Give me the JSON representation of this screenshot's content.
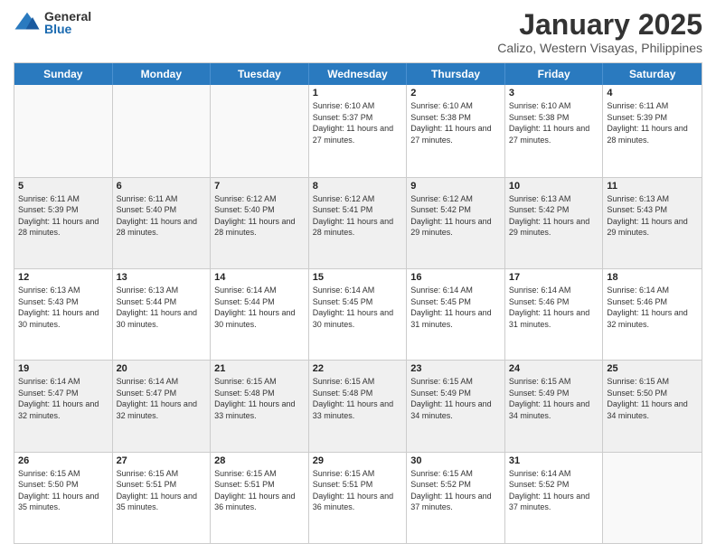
{
  "logo": {
    "general": "General",
    "blue": "Blue"
  },
  "header": {
    "month": "January 2025",
    "location": "Calizo, Western Visayas, Philippines"
  },
  "weekdays": [
    "Sunday",
    "Monday",
    "Tuesday",
    "Wednesday",
    "Thursday",
    "Friday",
    "Saturday"
  ],
  "weeks": [
    [
      {
        "day": "",
        "empty": true
      },
      {
        "day": "",
        "empty": true
      },
      {
        "day": "",
        "empty": true
      },
      {
        "day": "1",
        "sunrise": "6:10 AM",
        "sunset": "5:37 PM",
        "daylight": "11 hours and 27 minutes."
      },
      {
        "day": "2",
        "sunrise": "6:10 AM",
        "sunset": "5:38 PM",
        "daylight": "11 hours and 27 minutes."
      },
      {
        "day": "3",
        "sunrise": "6:10 AM",
        "sunset": "5:38 PM",
        "daylight": "11 hours and 27 minutes."
      },
      {
        "day": "4",
        "sunrise": "6:11 AM",
        "sunset": "5:39 PM",
        "daylight": "11 hours and 28 minutes."
      }
    ],
    [
      {
        "day": "5",
        "sunrise": "6:11 AM",
        "sunset": "5:39 PM",
        "daylight": "11 hours and 28 minutes."
      },
      {
        "day": "6",
        "sunrise": "6:11 AM",
        "sunset": "5:40 PM",
        "daylight": "11 hours and 28 minutes."
      },
      {
        "day": "7",
        "sunrise": "6:12 AM",
        "sunset": "5:40 PM",
        "daylight": "11 hours and 28 minutes."
      },
      {
        "day": "8",
        "sunrise": "6:12 AM",
        "sunset": "5:41 PM",
        "daylight": "11 hours and 28 minutes."
      },
      {
        "day": "9",
        "sunrise": "6:12 AM",
        "sunset": "5:42 PM",
        "daylight": "11 hours and 29 minutes."
      },
      {
        "day": "10",
        "sunrise": "6:13 AM",
        "sunset": "5:42 PM",
        "daylight": "11 hours and 29 minutes."
      },
      {
        "day": "11",
        "sunrise": "6:13 AM",
        "sunset": "5:43 PM",
        "daylight": "11 hours and 29 minutes."
      }
    ],
    [
      {
        "day": "12",
        "sunrise": "6:13 AM",
        "sunset": "5:43 PM",
        "daylight": "11 hours and 30 minutes."
      },
      {
        "day": "13",
        "sunrise": "6:13 AM",
        "sunset": "5:44 PM",
        "daylight": "11 hours and 30 minutes."
      },
      {
        "day": "14",
        "sunrise": "6:14 AM",
        "sunset": "5:44 PM",
        "daylight": "11 hours and 30 minutes."
      },
      {
        "day": "15",
        "sunrise": "6:14 AM",
        "sunset": "5:45 PM",
        "daylight": "11 hours and 30 minutes."
      },
      {
        "day": "16",
        "sunrise": "6:14 AM",
        "sunset": "5:45 PM",
        "daylight": "11 hours and 31 minutes."
      },
      {
        "day": "17",
        "sunrise": "6:14 AM",
        "sunset": "5:46 PM",
        "daylight": "11 hours and 31 minutes."
      },
      {
        "day": "18",
        "sunrise": "6:14 AM",
        "sunset": "5:46 PM",
        "daylight": "11 hours and 32 minutes."
      }
    ],
    [
      {
        "day": "19",
        "sunrise": "6:14 AM",
        "sunset": "5:47 PM",
        "daylight": "11 hours and 32 minutes."
      },
      {
        "day": "20",
        "sunrise": "6:14 AM",
        "sunset": "5:47 PM",
        "daylight": "11 hours and 32 minutes."
      },
      {
        "day": "21",
        "sunrise": "6:15 AM",
        "sunset": "5:48 PM",
        "daylight": "11 hours and 33 minutes."
      },
      {
        "day": "22",
        "sunrise": "6:15 AM",
        "sunset": "5:48 PM",
        "daylight": "11 hours and 33 minutes."
      },
      {
        "day": "23",
        "sunrise": "6:15 AM",
        "sunset": "5:49 PM",
        "daylight": "11 hours and 34 minutes."
      },
      {
        "day": "24",
        "sunrise": "6:15 AM",
        "sunset": "5:49 PM",
        "daylight": "11 hours and 34 minutes."
      },
      {
        "day": "25",
        "sunrise": "6:15 AM",
        "sunset": "5:50 PM",
        "daylight": "11 hours and 34 minutes."
      }
    ],
    [
      {
        "day": "26",
        "sunrise": "6:15 AM",
        "sunset": "5:50 PM",
        "daylight": "11 hours and 35 minutes."
      },
      {
        "day": "27",
        "sunrise": "6:15 AM",
        "sunset": "5:51 PM",
        "daylight": "11 hours and 35 minutes."
      },
      {
        "day": "28",
        "sunrise": "6:15 AM",
        "sunset": "5:51 PM",
        "daylight": "11 hours and 36 minutes."
      },
      {
        "day": "29",
        "sunrise": "6:15 AM",
        "sunset": "5:51 PM",
        "daylight": "11 hours and 36 minutes."
      },
      {
        "day": "30",
        "sunrise": "6:15 AM",
        "sunset": "5:52 PM",
        "daylight": "11 hours and 37 minutes."
      },
      {
        "day": "31",
        "sunrise": "6:14 AM",
        "sunset": "5:52 PM",
        "daylight": "11 hours and 37 minutes."
      },
      {
        "day": "",
        "empty": true
      }
    ]
  ],
  "labels": {
    "sunrise": "Sunrise:",
    "sunset": "Sunset:",
    "daylight": "Daylight:"
  }
}
